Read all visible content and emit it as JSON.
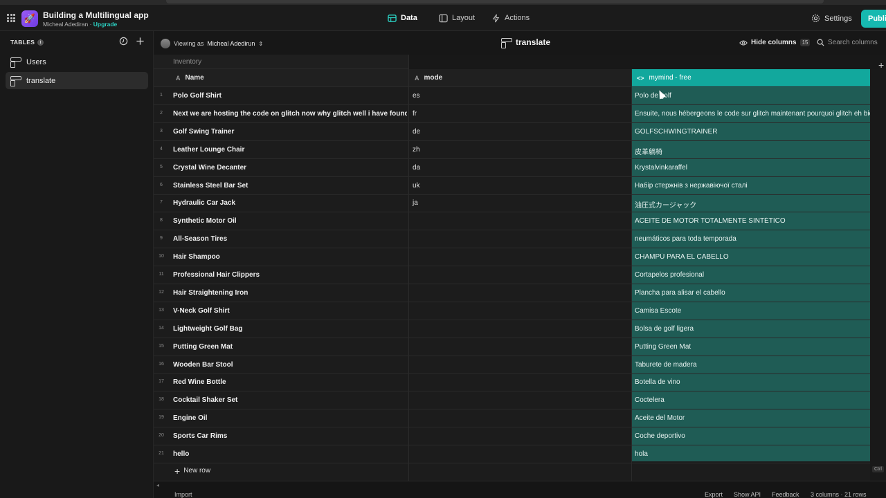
{
  "app": {
    "title": "Building a Multilingual app",
    "owner": "Micheal Adediran",
    "separator": " · ",
    "upgrade": "Upgrade",
    "logo_icon": "rocket-icon"
  },
  "nav": {
    "data": "Data",
    "layout": "Layout",
    "actions": "Actions",
    "settings": "Settings",
    "publish": "Publi"
  },
  "sidebar": {
    "heading": "TABLES",
    "items": [
      {
        "label": "Users"
      },
      {
        "label": "translate"
      }
    ]
  },
  "toolbar": {
    "viewing_prefix": "Viewing as",
    "viewing_user": "Micheal Adedirun",
    "table_name": "translate",
    "hide_columns": "Hide columns",
    "hidden_count": "15",
    "search_placeholder": "Search columns"
  },
  "grid": {
    "group": "Inventory",
    "columns": {
      "name": "Name",
      "mode": "mode",
      "mymind": "mymind - free",
      "type_text": "A",
      "type_code": "<>"
    },
    "rows": [
      {
        "n": "1",
        "name": "Polo Golf Shirt",
        "mode": "es",
        "tr": "Polo de golf"
      },
      {
        "n": "2",
        "name": "Next we are hosting the code on glitch now why glitch well i have found glitch",
        "mode": "fr",
        "tr": "Ensuite, nous hébergeons le code sur glitch maintenant pourquoi glitch eh bien"
      },
      {
        "n": "3",
        "name": "Golf Swing Trainer",
        "mode": "de",
        "tr": "GOLFSCHWINGTRAINER"
      },
      {
        "n": "4",
        "name": "Leather Lounge Chair",
        "mode": "zh",
        "tr": "皮革躺椅"
      },
      {
        "n": "5",
        "name": "Crystal Wine Decanter",
        "mode": "da",
        "tr": "Krystalvinkaraffel"
      },
      {
        "n": "6",
        "name": "Stainless Steel Bar Set",
        "mode": "uk",
        "tr": "Набір стержнів з нержавіючої сталі"
      },
      {
        "n": "7",
        "name": "Hydraulic Car Jack",
        "mode": "ja",
        "tr": "油圧式カージャック"
      },
      {
        "n": "8",
        "name": "Synthetic Motor Oil",
        "mode": "",
        "tr": "ACEITE DE MOTOR TOTALMENTE SINTÉTICO"
      },
      {
        "n": "9",
        "name": "All-Season Tires",
        "mode": "",
        "tr": "neumáticos para toda temporada"
      },
      {
        "n": "10",
        "name": "Hair Shampoo",
        "mode": "",
        "tr": "CHAMPÚ PARA EL CABELLO"
      },
      {
        "n": "11",
        "name": "Professional Hair Clippers",
        "mode": "",
        "tr": "Cortapelos profesional"
      },
      {
        "n": "12",
        "name": "Hair Straightening Iron",
        "mode": "",
        "tr": "Plancha para alisar el cabello"
      },
      {
        "n": "13",
        "name": "V-Neck Golf Shirt",
        "mode": "",
        "tr": "Camisa Escote"
      },
      {
        "n": "14",
        "name": "Lightweight Golf Bag",
        "mode": "",
        "tr": "Bolsa de golf ligera"
      },
      {
        "n": "15",
        "name": "Putting Green Mat",
        "mode": "",
        "tr": "Putting Green Mat"
      },
      {
        "n": "16",
        "name": "Wooden Bar Stool",
        "mode": "",
        "tr": "Taburete de madera"
      },
      {
        "n": "17",
        "name": "Red Wine Bottle",
        "mode": "",
        "tr": "Botella de vino"
      },
      {
        "n": "18",
        "name": "Cocktail Shaker Set",
        "mode": "",
        "tr": "Coctelera"
      },
      {
        "n": "19",
        "name": "Engine Oil",
        "mode": "",
        "tr": "Aceite del Motor"
      },
      {
        "n": "20",
        "name": "Sports Car Rims",
        "mode": "",
        "tr": "Coche deportivo"
      },
      {
        "n": "21",
        "name": "hello",
        "mode": "",
        "tr": "hola"
      }
    ],
    "new_row": "New row"
  },
  "footer": {
    "import": "Import",
    "export": "Export",
    "show_api": "Show API",
    "feedback": "Feedback",
    "summary": "3 columns · 21 rows"
  },
  "colors": {
    "accent": "#17b9b0",
    "column_highlight": "#12a89d",
    "column_body": "#1f5c55"
  }
}
